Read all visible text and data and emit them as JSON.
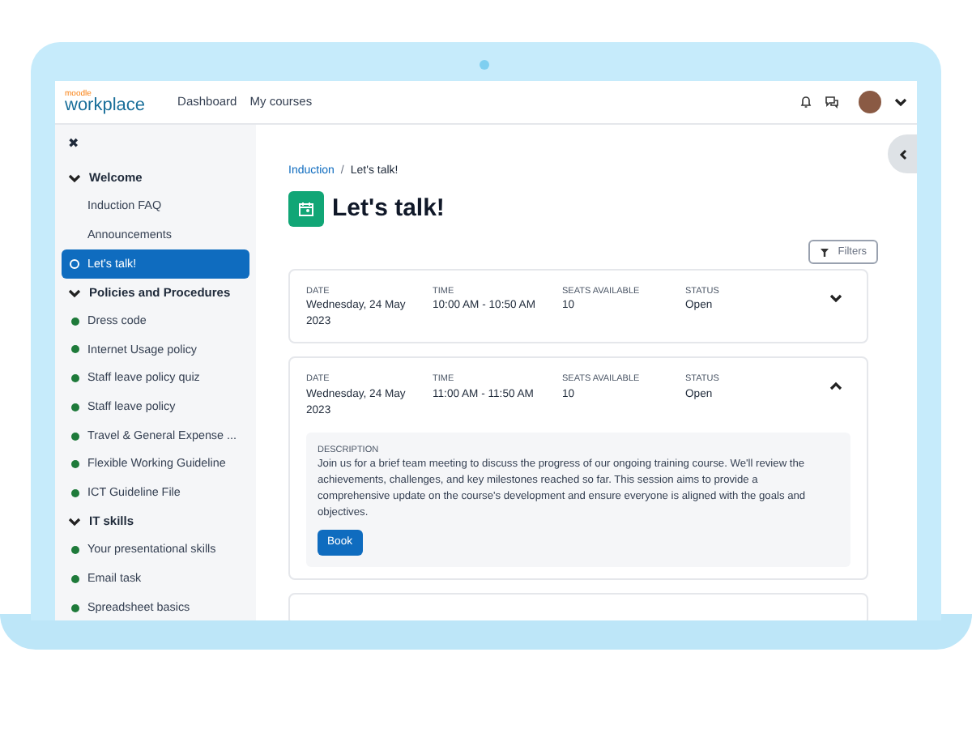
{
  "header": {
    "logo_small": "moodle",
    "logo": "workplace",
    "nav": [
      {
        "label": "Dashboard"
      },
      {
        "label": "My courses"
      }
    ]
  },
  "sidebar": {
    "close": "✖",
    "sections": [
      {
        "title": "Welcome",
        "expanded": true,
        "items": [
          {
            "label": "Induction FAQ",
            "kind": "plain",
            "selected": false
          },
          {
            "label": "Announcements",
            "kind": "plain",
            "selected": false
          },
          {
            "label": "Let's talk!",
            "kind": "pending",
            "selected": true
          }
        ]
      },
      {
        "title": "Policies and Procedures",
        "expanded": true,
        "items": [
          {
            "label": "Dress code",
            "kind": "done",
            "selected": false
          },
          {
            "label": "Internet Usage policy",
            "kind": "done",
            "selected": false
          },
          {
            "label": "Staff leave policy quiz",
            "kind": "done",
            "selected": false
          },
          {
            "label": "Staff leave policy",
            "kind": "done",
            "selected": false
          },
          {
            "label": "Travel & General Expense ...",
            "kind": "done",
            "selected": false
          },
          {
            "label": "Flexible Working Guideline",
            "kind": "done",
            "selected": false
          },
          {
            "label": "ICT Guideline File",
            "kind": "done",
            "selected": false
          }
        ]
      },
      {
        "title": "IT skills",
        "expanded": true,
        "items": [
          {
            "label": "Your presentational skills",
            "kind": "done",
            "selected": false
          },
          {
            "label": "Email task",
            "kind": "done",
            "selected": false
          },
          {
            "label": "Spreadsheet basics",
            "kind": "done",
            "selected": false
          }
        ]
      }
    ]
  },
  "breadcrumb": [
    {
      "label": "Induction"
    },
    {
      "label": "Let's talk!"
    }
  ],
  "breadcrumb_separator": "/",
  "title": "Let's talk!",
  "filters_button": "Filters",
  "sessions": [
    {
      "expanded": false,
      "fields": [
        {
          "label": "DATE",
          "value": "Wednesday, 24 May 2023"
        },
        {
          "label": "TIME",
          "value": "10:00 AM - 10:50 AM"
        },
        {
          "label": "SEATS AVAILABLE",
          "value": "10"
        },
        {
          "label": "STATUS",
          "value": "Open"
        }
      ]
    },
    {
      "expanded": true,
      "fields": [
        {
          "label": "DATE",
          "value": "Wednesday, 24 May 2023"
        },
        {
          "label": "TIME",
          "value": "11:00 AM - 11:50 AM"
        },
        {
          "label": "SEATS AVAILABLE",
          "value": "10"
        },
        {
          "label": "STATUS",
          "value": "Open"
        }
      ],
      "description_label": "DESCRIPTION",
      "description": "Join us for a brief team meeting to discuss the progress of our ongoing training course. We'll review the achievements, challenges, and key milestones reached so far. This session aims to provide a comprehensive update on the course's development and ensure everyone is aligned with the goals and objectives.",
      "button": "Book"
    }
  ]
}
